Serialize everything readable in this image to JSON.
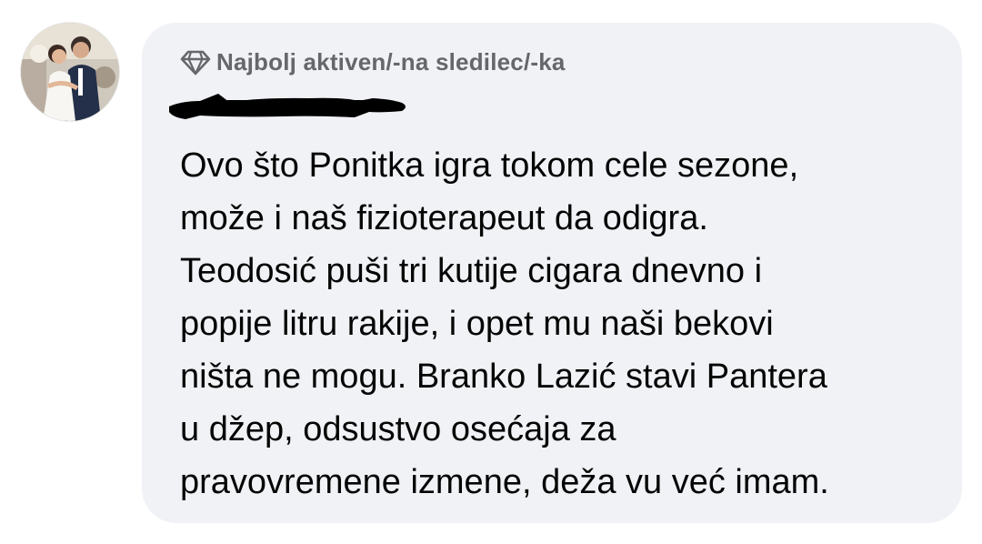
{
  "comment": {
    "badge": {
      "icon": "diamond-icon",
      "label": "Najbolj aktiven/-na sledilec/-ka"
    },
    "author": {
      "avatar": "avatar",
      "name_redacted": true
    },
    "text_lines": [
      "Ovo što Ponitka igra tokom cele sezone,",
      "može i naš fizioterapeut da odigra.",
      "Teodosić puši tri kutije cigara dnevno i",
      "popije litru rakije, i opet mu naši bekovi",
      "ništa ne mogu. Branko Lazić stavi Pantera",
      "u džep, odsustvo osećaja za",
      "pravovremene izmene, deža vu već imam."
    ]
  },
  "colors": {
    "bubble_background": "#f0f2f5",
    "badge_text": "#65676b",
    "body_text": "#050505",
    "redaction": "#000000"
  }
}
